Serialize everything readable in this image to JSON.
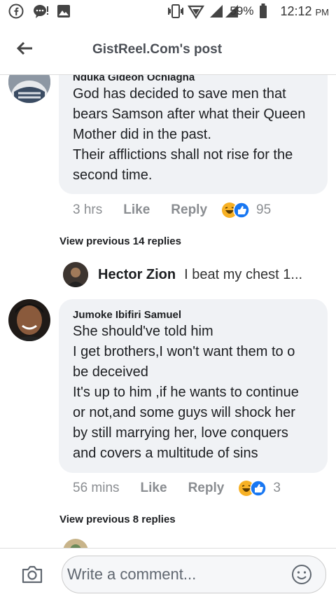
{
  "status_bar": {
    "battery": "59%",
    "time": "12:12",
    "ampm": "PM"
  },
  "header": {
    "title": "GistReel.Com's post"
  },
  "comments": [
    {
      "author": "Nduka Gideon Ochiagha",
      "text": "God has decided to save men that\nbears Samson after what their Queen\nMother did in the past.\nTheir afflictions shall not rise for the\nsecond time.",
      "time": "3 hrs",
      "like": "Like",
      "reply": "Reply",
      "reactions": "95",
      "view_previous": "View previous 14 replies",
      "reply_preview": {
        "author": "Hector Zion",
        "text": "I beat my chest 1..."
      }
    },
    {
      "author": "Jumoke Ibifiri Samuel",
      "text": "She should've told him\nI get brothers,I won't want them to o\nbe deceived\nIt's up to him ,if he wants to continue\nor not,and some guys will shock her\nby still marrying her, love conquers\nand covers a multitude of sins",
      "time": "56 mins",
      "like": "Like",
      "reply": "Reply",
      "reactions": "3",
      "view_previous": "View previous 8 replies"
    }
  ],
  "composer": {
    "placeholder": "Write a comment..."
  },
  "icons": [
    "facebook-icon",
    "messenger-icon",
    "gallery-icon",
    "vibrate-icon",
    "data-icon",
    "signal-icon",
    "battery-icon",
    "back-arrow-icon",
    "haha-reaction-icon",
    "like-reaction-icon",
    "camera-icon",
    "emoji-icon"
  ]
}
